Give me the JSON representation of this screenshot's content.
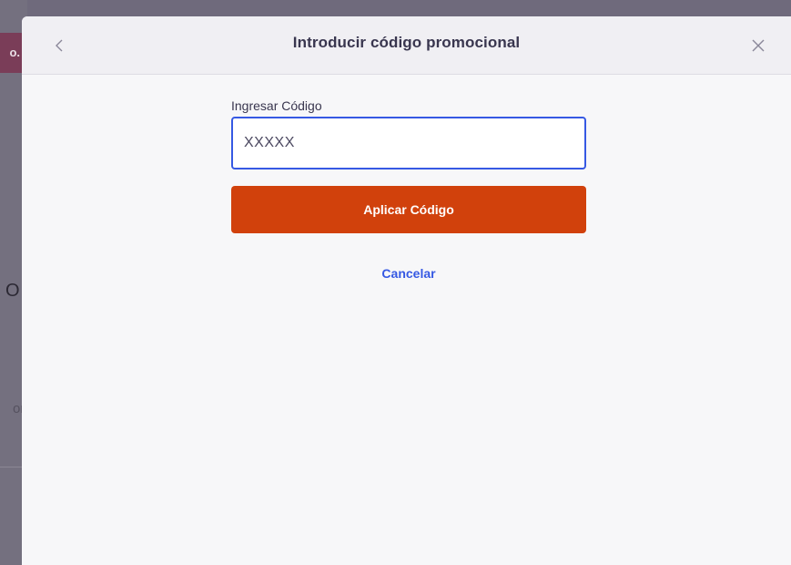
{
  "backdrop": {
    "tab_text": "o.",
    "letter": "O",
    "faint_text": "or"
  },
  "modal": {
    "title": "Introducir código promocional",
    "back_icon": "chevron-left-icon",
    "close_icon": "close-icon"
  },
  "form": {
    "label": "Ingresar Código",
    "input_placeholder": "XXXXX",
    "input_value": "",
    "apply_label": "Aplicar Código",
    "cancel_label": "Cancelar"
  },
  "colors": {
    "accent_button": "#d1410c",
    "link": "#3659e3",
    "input_focus_border": "#3659e3",
    "title_text": "#39364f"
  }
}
